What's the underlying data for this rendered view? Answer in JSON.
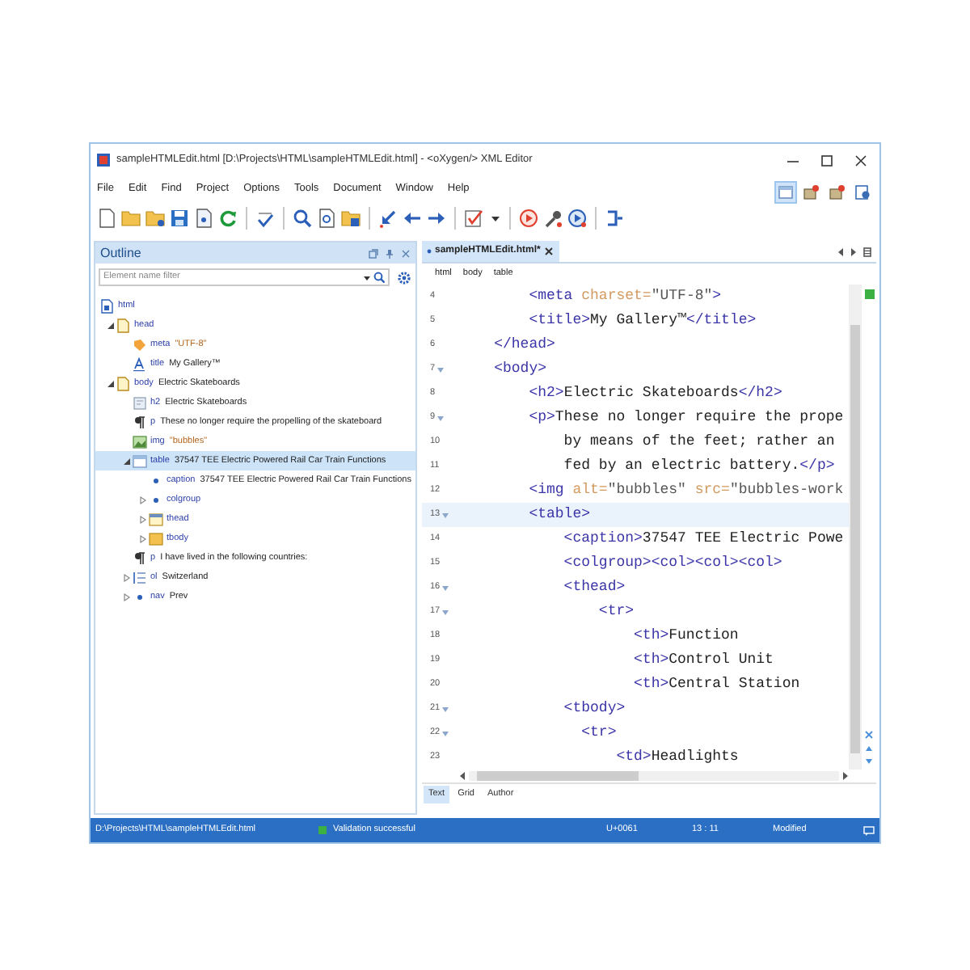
{
  "window": {
    "title": "sampleHTMLEdit.html [D:\\Projects\\HTML\\sampleHTMLEdit.html] - <oXygen/> XML Editor"
  },
  "menu": [
    "File",
    "Edit",
    "Find",
    "Project",
    "Options",
    "Tools",
    "Document",
    "Window",
    "Help"
  ],
  "perspectives": [
    {
      "selected": true
    },
    {
      "selected": false
    },
    {
      "selected": false
    },
    {
      "selected": false
    }
  ],
  "outline": {
    "title": "Outline",
    "filter": {
      "placeholder": "Element name filter"
    },
    "tree": [
      {
        "kind": "document",
        "tag": "html",
        "children": [
          {
            "kind": "page",
            "tag": "head",
            "expanded": true,
            "selected": false,
            "children": [
              {
                "kind": "meta",
                "tag": "meta",
                "detail": {
                  "kind": "value",
                  "text": "\"UTF-8\""
                },
                "selected": false
              },
              {
                "kind": "font",
                "tag": "title",
                "detail": {
                  "kind": "text",
                  "text": "My Gallery™"
                },
                "selected": false
              }
            ]
          },
          {
            "kind": "page",
            "tag": "body",
            "detail": {
              "kind": "text",
              "text": "Electric Skateboards"
            },
            "expanded": true,
            "selected": false,
            "children": [
              {
                "kind": "heading",
                "tag": "h2",
                "detail": {
                  "kind": "text",
                  "text": "Electric Skateboards"
                },
                "selected": false
              },
              {
                "kind": "paragraph",
                "tag": "p",
                "detail": {
                  "kind": "text",
                  "text": "These no longer require the propelling of the skateboard"
                },
                "selected": false
              },
              {
                "kind": "image",
                "tag": "img",
                "detail": {
                  "kind": "value",
                  "text": "\"bubbles\""
                },
                "selected": false
              },
              {
                "kind": "table",
                "tag": "table",
                "detail": {
                  "kind": "text",
                  "text": "37547 TEE Electric Powered Rail Car Train Functions"
                },
                "expanded": true,
                "selected": true,
                "children": [
                  {
                    "kind": "dot",
                    "tag": "caption",
                    "detail": {
                      "kind": "text",
                      "text": "37547 TEE Electric Powered Rail Car Train Functions"
                    },
                    "selected": false
                  },
                  {
                    "kind": "dot",
                    "tag": "colgroup",
                    "expanded": false,
                    "selected": false
                  },
                  {
                    "kind": "thead",
                    "tag": "thead",
                    "expanded": false,
                    "selected": false
                  },
                  {
                    "kind": "tbody",
                    "tag": "tbody",
                    "expanded": false,
                    "selected": false
                  }
                ]
              },
              {
                "kind": "paragraph",
                "tag": "p",
                "detail": {
                  "kind": "text",
                  "text": "I have lived in the following countries:"
                },
                "selected": false
              },
              {
                "kind": "list",
                "tag": "ol",
                "detail": {
                  "kind": "text",
                  "text": "Switzerland"
                },
                "expanded": false,
                "selected": false
              },
              {
                "kind": "dot",
                "tag": "nav",
                "detail": {
                  "kind": "text",
                  "text": "Prev"
                },
                "expanded": false,
                "selected": false
              }
            ]
          }
        ]
      }
    ]
  },
  "editor": {
    "tabs": [
      {
        "label": "sampleHTMLEdit.html*",
        "selected": true,
        "modified": true
      }
    ],
    "breadcrumbs": [
      "html",
      "body",
      "table"
    ],
    "lines": [
      {
        "number": "4",
        "fold": false,
        "current": false,
        "segments": [
          {
            "kind": "tag",
            "text": "        <meta "
          },
          {
            "kind": "attr",
            "text": "charset="
          },
          {
            "kind": "value",
            "text": "\"UTF-8\""
          },
          {
            "kind": "tag",
            "text": ">"
          }
        ]
      },
      {
        "number": "5",
        "fold": false,
        "current": false,
        "segments": [
          {
            "kind": "tag",
            "text": "        <title>"
          },
          {
            "kind": "text",
            "text": "My Gallery™"
          },
          {
            "kind": "tag",
            "text": "</title>"
          }
        ]
      },
      {
        "number": "6",
        "fold": false,
        "current": false,
        "segments": [
          {
            "kind": "tag",
            "text": "    </head>"
          }
        ]
      },
      {
        "number": "7",
        "fold": true,
        "current": false,
        "segments": [
          {
            "kind": "tag",
            "text": "    <body>"
          }
        ]
      },
      {
        "number": "8",
        "fold": false,
        "current": false,
        "segments": [
          {
            "kind": "tag",
            "text": "        <h2>"
          },
          {
            "kind": "text",
            "text": "Electric Skateboards"
          },
          {
            "kind": "tag",
            "text": "</h2>"
          }
        ]
      },
      {
        "number": "9",
        "fold": true,
        "current": false,
        "segments": [
          {
            "kind": "tag",
            "text": "        <p>"
          },
          {
            "kind": "text",
            "text": "These no longer require the prope"
          }
        ]
      },
      {
        "number": "10",
        "fold": false,
        "current": false,
        "segments": [
          {
            "kind": "text",
            "text": "            by means of the feet; rather an"
          }
        ]
      },
      {
        "number": "11",
        "fold": false,
        "current": false,
        "segments": [
          {
            "kind": "text",
            "text": "            fed by an electric battery."
          },
          {
            "kind": "tag",
            "text": "</p>"
          }
        ]
      },
      {
        "number": "12",
        "fold": false,
        "current": false,
        "segments": [
          {
            "kind": "tag",
            "text": "        <img "
          },
          {
            "kind": "attr",
            "text": "alt="
          },
          {
            "kind": "value",
            "text": "\"bubbles\" "
          },
          {
            "kind": "attr",
            "text": "src="
          },
          {
            "kind": "value",
            "text": "\"bubbles-work"
          }
        ]
      },
      {
        "number": "13",
        "fold": true,
        "current": true,
        "segments": [
          {
            "kind": "tag",
            "text": "        <table>"
          }
        ]
      },
      {
        "number": "14",
        "fold": false,
        "current": false,
        "segments": [
          {
            "kind": "tag",
            "text": "            <caption>"
          },
          {
            "kind": "text",
            "text": "37547 TEE Electric Powe"
          }
        ]
      },
      {
        "number": "15",
        "fold": false,
        "current": false,
        "segments": [
          {
            "kind": "tag",
            "text": "            <colgroup><col><col><col>"
          }
        ]
      },
      {
        "number": "16",
        "fold": true,
        "current": false,
        "segments": [
          {
            "kind": "tag",
            "text": "            <thead>"
          }
        ]
      },
      {
        "number": "17",
        "fold": true,
        "current": false,
        "segments": [
          {
            "kind": "tag",
            "text": "                <tr>"
          }
        ]
      },
      {
        "number": "18",
        "fold": false,
        "current": false,
        "segments": [
          {
            "kind": "tag",
            "text": "                    <th>"
          },
          {
            "kind": "text",
            "text": "Function"
          }
        ]
      },
      {
        "number": "19",
        "fold": false,
        "current": false,
        "segments": [
          {
            "kind": "tag",
            "text": "                    <th>"
          },
          {
            "kind": "text",
            "text": "Control Unit"
          }
        ]
      },
      {
        "number": "20",
        "fold": false,
        "current": false,
        "segments": [
          {
            "kind": "tag",
            "text": "                    <th>"
          },
          {
            "kind": "text",
            "text": "Central Station"
          }
        ]
      },
      {
        "number": "21",
        "fold": true,
        "current": false,
        "segments": [
          {
            "kind": "tag",
            "text": "            <tbody>"
          }
        ]
      },
      {
        "number": "22",
        "fold": true,
        "current": false,
        "segments": [
          {
            "kind": "tag",
            "text": "              <tr>"
          }
        ]
      },
      {
        "number": "23",
        "fold": false,
        "current": false,
        "segments": [
          {
            "kind": "tag",
            "text": "                  <td>"
          },
          {
            "kind": "text",
            "text": "Headlights"
          }
        ]
      }
    ],
    "view_tabs": [
      {
        "label": "Text",
        "selected": true
      },
      {
        "label": "Grid",
        "selected": false
      },
      {
        "label": "Author",
        "selected": false
      }
    ]
  },
  "status_bar": {
    "path": "D:\\Projects\\HTML\\sampleHTMLEdit.html",
    "validation": {
      "text": "Validation successful",
      "color": "#3cb043"
    },
    "unicode": "U+0061",
    "position": "13 : 11",
    "state": "Modified"
  }
}
